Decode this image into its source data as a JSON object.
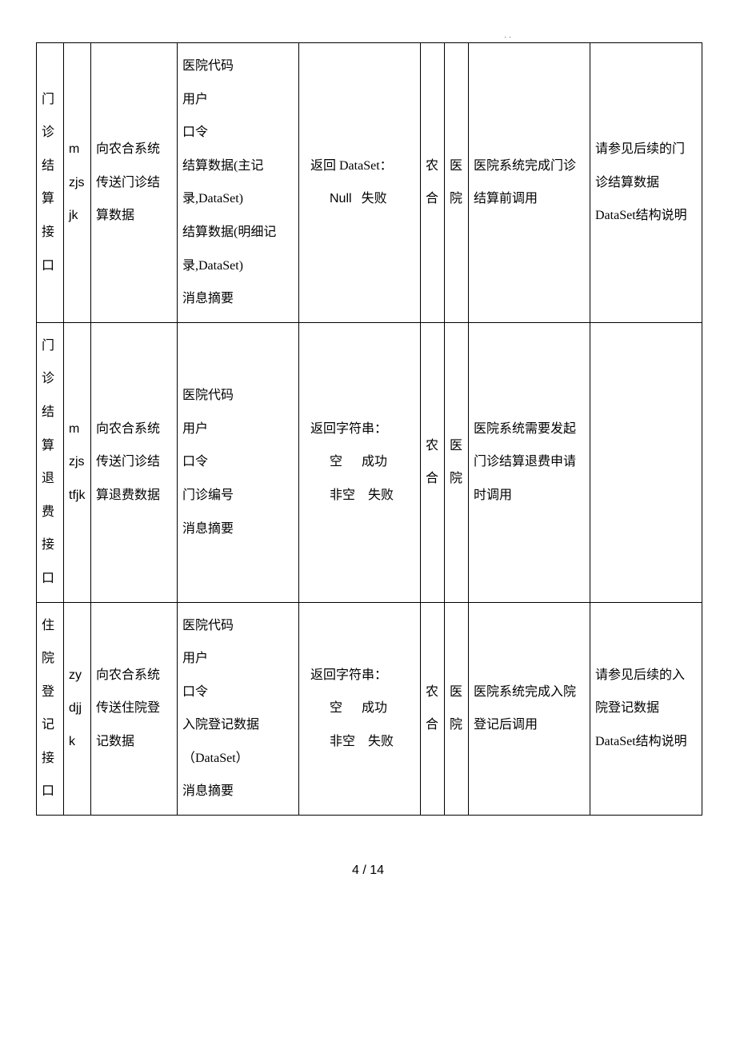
{
  "page_marker": ". .",
  "footer": "4 / 14",
  "rows": [
    {
      "name": "门诊结算接口",
      "code": "mzjsjk",
      "desc": "向农合系统传送门诊结算数据",
      "params": [
        "医院代码",
        "用户",
        "口令",
        "结算数据(主记录,DataSet)",
        "结算数据(明细记录,DataSet)",
        "消息摘要"
      ],
      "return": {
        "title": "返回 DataSet：",
        "lines": [
          [
            "Null",
            "失败"
          ]
        ]
      },
      "provider": "农合",
      "implementer": "医院",
      "when": "医院系统完成门诊结算前调用",
      "note": "请参见后续的门诊结算数据 DataSet结构说明"
    },
    {
      "name": "门诊结算退费接口",
      "code": "mzjstfjk",
      "desc": "向农合系统传送门诊结算退费数据",
      "params": [
        "医院代码",
        "用户",
        "口令",
        "门诊编号",
        "消息摘要"
      ],
      "return": {
        "title": "返回字符串：",
        "lines": [
          [
            "空",
            "成功"
          ],
          [
            "非空",
            "失败"
          ]
        ]
      },
      "provider": "农合",
      "implementer": "医院",
      "when": "医院系统需要发起门诊结算退费申请时调用",
      "note": ""
    },
    {
      "name": "住院登记接口",
      "code": "zydjjk",
      "desc": "向农合系统传送住院登记数据",
      "params": [
        "医院代码",
        "用户",
        "口令",
        "入院登记数据（DataSet）",
        "消息摘要"
      ],
      "return": {
        "title": "返回字符串：",
        "lines": [
          [
            "空",
            "成功"
          ],
          [
            "非空",
            "失败"
          ]
        ]
      },
      "provider": "农合",
      "implementer": "医院",
      "when": "医院系统完成入院登记后调用",
      "note": "请参见后续的入院登记数据 DataSet结构说明"
    }
  ]
}
